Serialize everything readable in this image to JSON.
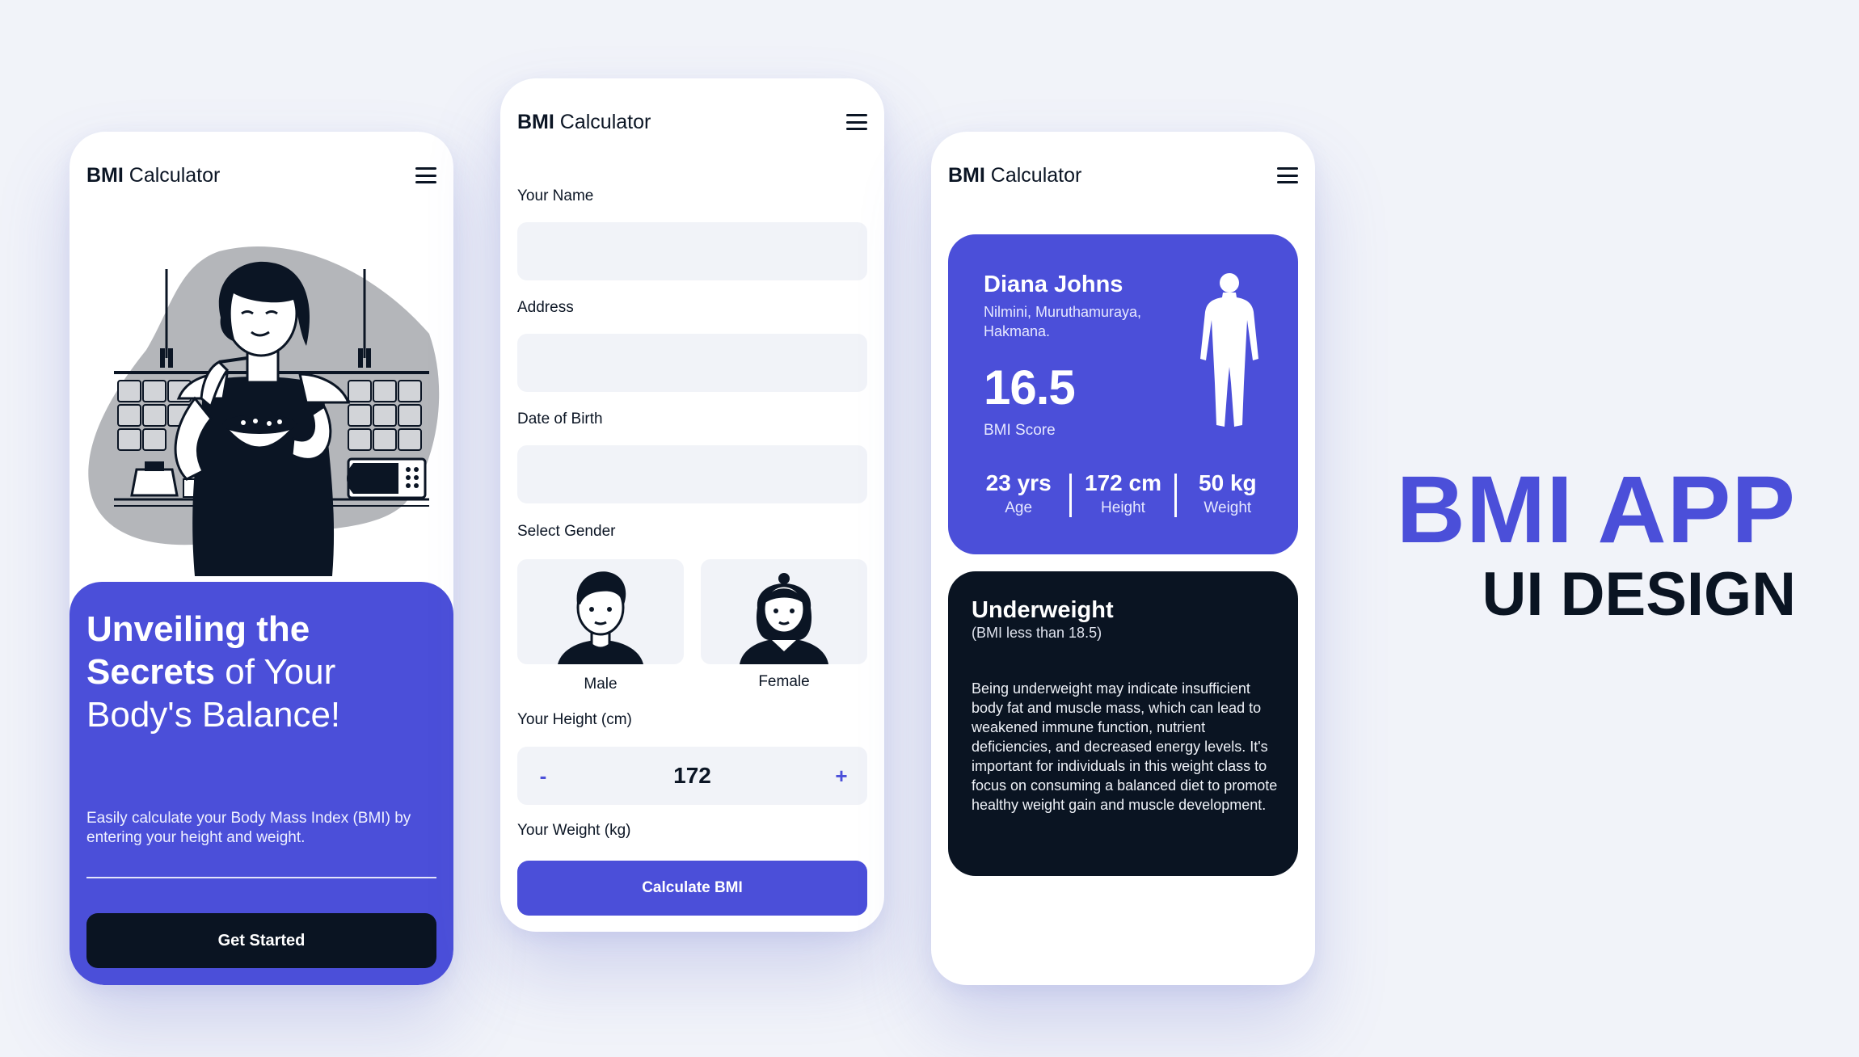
{
  "app": {
    "brand_bold": "BMI",
    "brand_rest": " Calculator"
  },
  "welcome": {
    "title_bold_1": "Unveiling the",
    "title_bold_2": "Secrets",
    "title_rest_2": " of Your",
    "title_line_3": "Body's Balance!",
    "description": "Easily calculate your Body Mass Index (BMI) by entering your height and weight.",
    "button": "Get Started"
  },
  "form": {
    "name_label": "Your Name",
    "name_value": "",
    "address_label": "Address",
    "address_value": "",
    "dob_label": "Date of Birth",
    "dob_value": "",
    "gender_label": "Select Gender",
    "gender_male": "Male",
    "gender_female": "Female",
    "height_label": "Your Height (cm)",
    "height_minus": "-",
    "height_value": "172",
    "height_plus": "+",
    "weight_label": "Your Weight (kg)",
    "button": "Calculate BMI"
  },
  "result": {
    "name": "Diana Johns",
    "address": "Nilmini, Muruthamuraya, Hakmana.",
    "score": "16.5",
    "score_label": "BMI Score",
    "stats": [
      {
        "value": "23 yrs",
        "label": "Age"
      },
      {
        "value": "172 cm",
        "label": "Height"
      },
      {
        "value": "50 kg",
        "label": "Weight"
      }
    ],
    "category": "Underweight",
    "category_sub": "(BMI less than 18.5)",
    "category_body": "Being underweight may indicate insufficient body fat and muscle mass, which can lead to weakened immune function, nutrient deficiencies, and decreased energy levels. It's important for individuals in this weight class to focus on consuming a balanced diet to promote healthy weight gain and muscle development."
  },
  "headline": {
    "line1": "BMI APP",
    "line2": "UI DESIGN"
  },
  "colors": {
    "primary": "#4b4fd9",
    "dark": "#0a1422",
    "background": "#f1f3f9",
    "field": "#f1f3f8"
  },
  "icons": [
    "menu-icon",
    "woman-eating-illustration",
    "male-avatar-icon",
    "female-avatar-icon",
    "body-silhouette-icon"
  ]
}
